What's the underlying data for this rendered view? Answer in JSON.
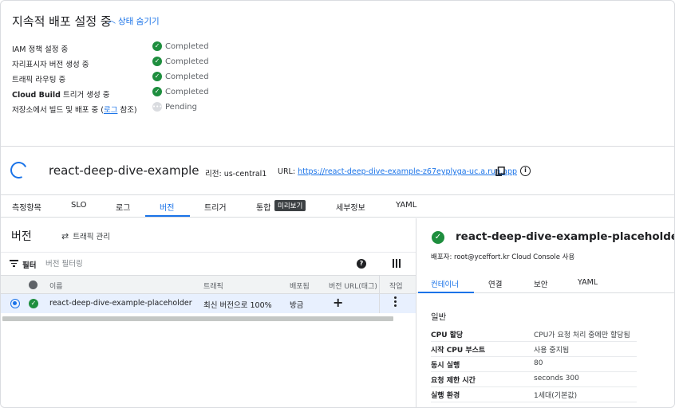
{
  "progress": {
    "title": "지속적 배포 설정 중",
    "hide_link": "상태 숨기기",
    "steps": [
      {
        "label": "IAM 정책 설정 중",
        "status": "Completed"
      },
      {
        "label": "자리표시자 버전 생성 중",
        "status": "Completed"
      },
      {
        "label": "트래픽 라우팅 중",
        "status": "Completed"
      },
      {
        "label_bold": "Cloud Build",
        "label_rest": " 트리거 생성 중",
        "status": "Completed"
      },
      {
        "label_pre": "저장소에서 빌드 및 배포 중 (",
        "label_link": "로그",
        "label_post": " 참조)",
        "status": "Pending"
      }
    ]
  },
  "service": {
    "name": "react-deep-dive-example",
    "region": "리전: us-central1",
    "url_label": "URL: ",
    "url": "https://react-deep-dive-example-z67eyplyga-uc.a.run.app"
  },
  "tabs": [
    {
      "label": "측정항목"
    },
    {
      "label": "SLO"
    },
    {
      "label": "로그"
    },
    {
      "label": "버전"
    },
    {
      "label": "트리거"
    },
    {
      "label": "통합"
    },
    {
      "label": "세부정보"
    },
    {
      "label": "YAML"
    }
  ],
  "preview_badge": "미리보기",
  "revisions": {
    "title": "버전",
    "traffic_button": "트래픽 관리",
    "filter_label": "필터",
    "filter_placeholder": "버전 필터링",
    "columns": [
      "이름",
      "트래픽",
      "배포됨",
      "버전 URL(태그)",
      "작업"
    ],
    "rows": [
      {
        "name": "react-deep-dive-example-placeholder",
        "traffic": "최신 버전으로 100%",
        "deployed": "방금"
      }
    ]
  },
  "detail": {
    "title": "react-deep-dive-example-placeholder",
    "deployer": "배포자: root@yceffort.kr Cloud Console 사용",
    "tabs": [
      "컨테이너",
      "연결",
      "보안",
      "YAML"
    ],
    "section": "일반",
    "rows": [
      {
        "key": "CPU 할당",
        "value": "CPU가 요청 처리 중에만 할당됨"
      },
      {
        "key": "시작 CPU 부스트",
        "value": "사용 중지됨"
      },
      {
        "key": "동시 실행",
        "value": "80"
      },
      {
        "key": "요청 제한 시간",
        "value": "seconds 300"
      },
      {
        "key": "실행 환경",
        "value": "1세대(기본값)"
      }
    ]
  },
  "colors": {
    "accent": "#1a73e8",
    "success": "#1e8e3e",
    "pending": "#dadce0"
  }
}
